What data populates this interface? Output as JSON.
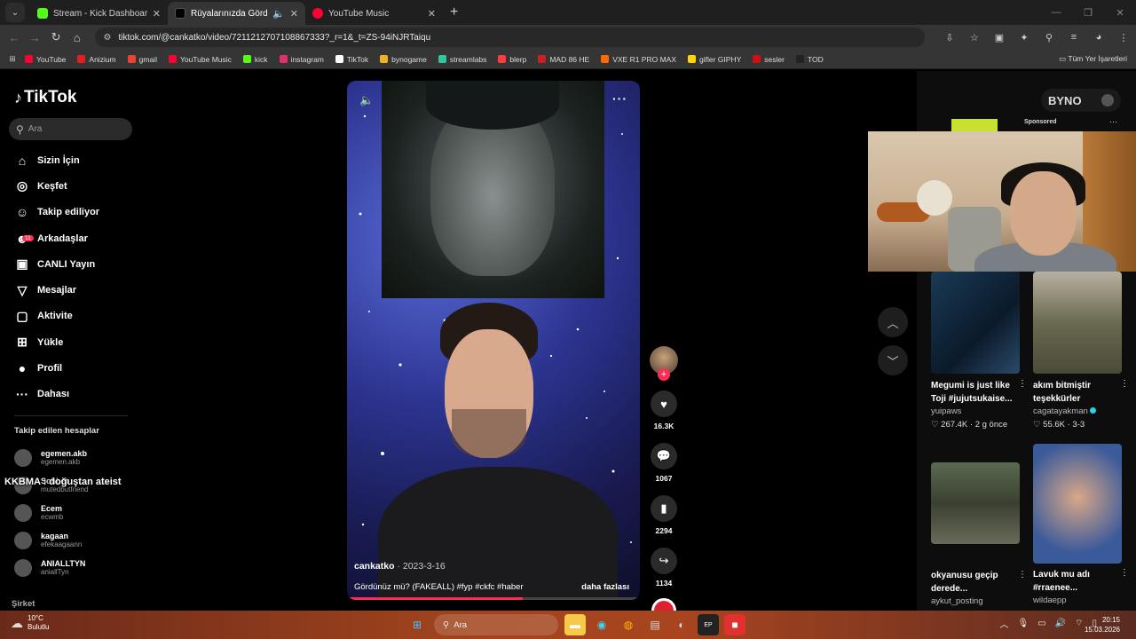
{
  "browser": {
    "tabs": [
      {
        "title": "Stream - Kick Dashboard",
        "color": "#53fc18"
      },
      {
        "title": "Rüyalarınızda Gördüğünüz",
        "color": "#ffffff"
      },
      {
        "title": "YouTube Music",
        "color": "#ff0033"
      }
    ],
    "url": "tiktok.com/@cankatko/video/7211212707108867333?_r=1&_t=ZS-94iNJRTaiqu",
    "bookmarks": [
      "YouTube",
      "Anizium",
      "gmail",
      "YouTube Music",
      "kick",
      "instagram",
      "TikTok",
      "bynogame",
      "streamlabs",
      "blerp",
      "MAD 86 HE",
      "VXE R1 PRO MAX",
      "gifler GIPHY",
      "sesler",
      "TOD"
    ],
    "bookmark_colors": [
      "#ff0033",
      "#e02020",
      "#ea4335",
      "#ff0033",
      "#53fc18",
      "#e1306c",
      "#ffffff",
      "#f0b020",
      "#31c3a2",
      "#ff3b3b",
      "#cc2020",
      "#ff6a00",
      "#ffd400",
      "#d01010",
      "#222222"
    ],
    "all_bookmarks": "Tüm Yer İşaretleri"
  },
  "tiktok": {
    "logo": "TikTok",
    "search_placeholder": "Ara",
    "nav": [
      {
        "icon": "⌂",
        "label": "Sizin İçin"
      },
      {
        "icon": "◎",
        "label": "Keşfet"
      },
      {
        "icon": "☺",
        "label": "Takip ediliyor"
      },
      {
        "icon": "☻",
        "label": "Arkadaşlar"
      },
      {
        "icon": "▣",
        "label": "CANLI Yayın"
      },
      {
        "icon": "▽",
        "label": "Mesajlar"
      },
      {
        "icon": "▢",
        "label": "Aktivite"
      },
      {
        "icon": "⊞",
        "label": "Yükle"
      },
      {
        "icon": "●",
        "label": "Profil"
      },
      {
        "icon": "···",
        "label": "Dahası"
      }
    ],
    "activity_badge": "11",
    "following_title": "Takip edilen hesaplar",
    "following": [
      {
        "name": "egemen.akb",
        "handle": "egemen.akb"
      },
      {
        "name": "Sohbet",
        "handle": "mutedbutfriend"
      },
      {
        "name": "Ecem",
        "handle": "ecwmb"
      },
      {
        "name": "kagaan",
        "handle": "efekaagaann"
      },
      {
        "name": "ANIALLTYN",
        "handle": "aniallTyn"
      }
    ],
    "company": "Şirket",
    "overlay_text": "KKBMA : doğuştan ateist"
  },
  "video": {
    "author": "cankatko",
    "date": "2023-3-16",
    "caption": "Gördünüz mü? (FAKEALL) #fyp #ckfc #haber",
    "more": "daha fazlası",
    "progress": 0.6,
    "likes": "16.3K",
    "comments": "1067",
    "saves": "2294",
    "shares": "1134"
  },
  "sidebar_right": {
    "byno": "BYNO",
    "sponsored": "Sponsored",
    "cards": [
      {
        "title": "Megumi is just like Toji #jujutsukaise...",
        "user": "yuipaws",
        "stats": "♡ 267.4K · 2 g önce",
        "verified": false
      },
      {
        "title": "akım bitmiştir teşekkürler",
        "user": "cagatayakman",
        "stats": "♡ 55.6K · 3-3",
        "verified": true
      },
      {
        "title": "okyanusu geçip derede...",
        "user": "aykut_posting",
        "stats": "",
        "verified": false
      },
      {
        "title": "Lavuk mu adı #rraenee...",
        "user": "wildaepp",
        "stats": "",
        "verified": false
      }
    ]
  },
  "taskbar": {
    "temp": "10°C",
    "weather": "Bulutlu",
    "search": "Ara",
    "time": "20:15",
    "date": "15.03.2026"
  }
}
